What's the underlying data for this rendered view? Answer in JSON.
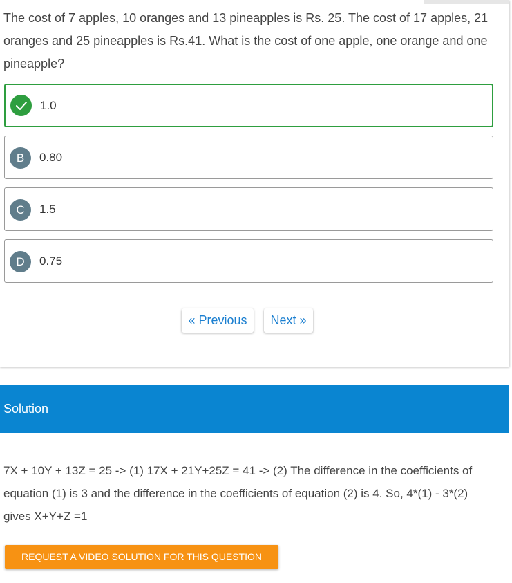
{
  "question": {
    "text": "The cost of 7 apples, 10 oranges and 13 pineapples is Rs. 25. The cost of 17 apples, 21 oranges and 25 pineapples is Rs.41. What is the cost of one apple, one orange and one pineapple?"
  },
  "options": [
    {
      "badge": "✓",
      "text": "1.0",
      "correct": true,
      "icon": "check-icon"
    },
    {
      "badge": "B",
      "text": "0.80",
      "correct": false
    },
    {
      "badge": "C",
      "text": "1.5",
      "correct": false
    },
    {
      "badge": "D",
      "text": "0.75",
      "correct": false
    }
  ],
  "navigation": {
    "previous_label": "« Previous",
    "next_label": "Next »"
  },
  "solution": {
    "title": "Solution",
    "text": "7X + 10Y + 13Z = 25 -> (1) 17X + 21Y+25Z = 41 -> (2) The difference in the coefficients of equation (1) is 3 and the difference in the coefficients of equation (2) is 4. So, 4*(1) - 3*(2) gives X+Y+Z =1",
    "video_button_label": "REQUEST A VIDEO SOLUTION FOR THIS QUESTION"
  },
  "colors": {
    "correct": "#2e9e3f",
    "badge": "#607d8b",
    "link": "#1b7fd0",
    "solution_header": "#0a85d1",
    "video_button": "#f79213"
  }
}
